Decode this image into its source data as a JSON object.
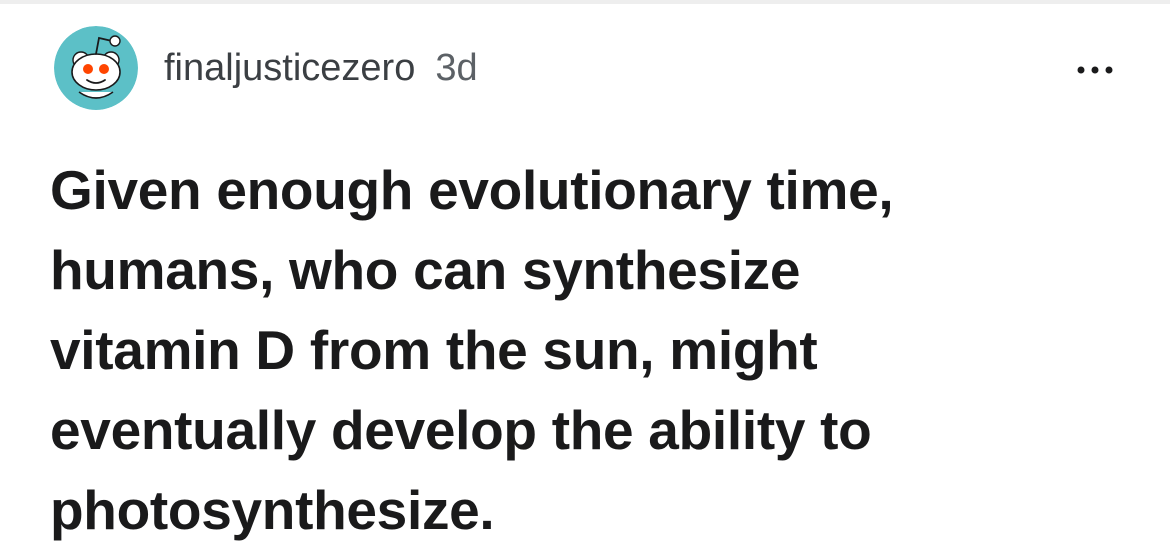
{
  "post": {
    "author": {
      "username": "finaljusticezero",
      "age": "3d",
      "avatar_icon": "reddit-snoo-avatar-icon"
    },
    "more_icon": "more-horizontal-icon",
    "body_lines": [
      "Given enough evolutionary time,",
      "humans, who can synthesize",
      "vitamin D from the sun, might",
      "eventually develop the ability to",
      "photosynthesize."
    ]
  },
  "colors": {
    "avatar_background": "#5cc0c7",
    "avatar_eye": "#ff4500",
    "text_primary": "#1a1a1b",
    "text_meta": "#3b3f43"
  }
}
